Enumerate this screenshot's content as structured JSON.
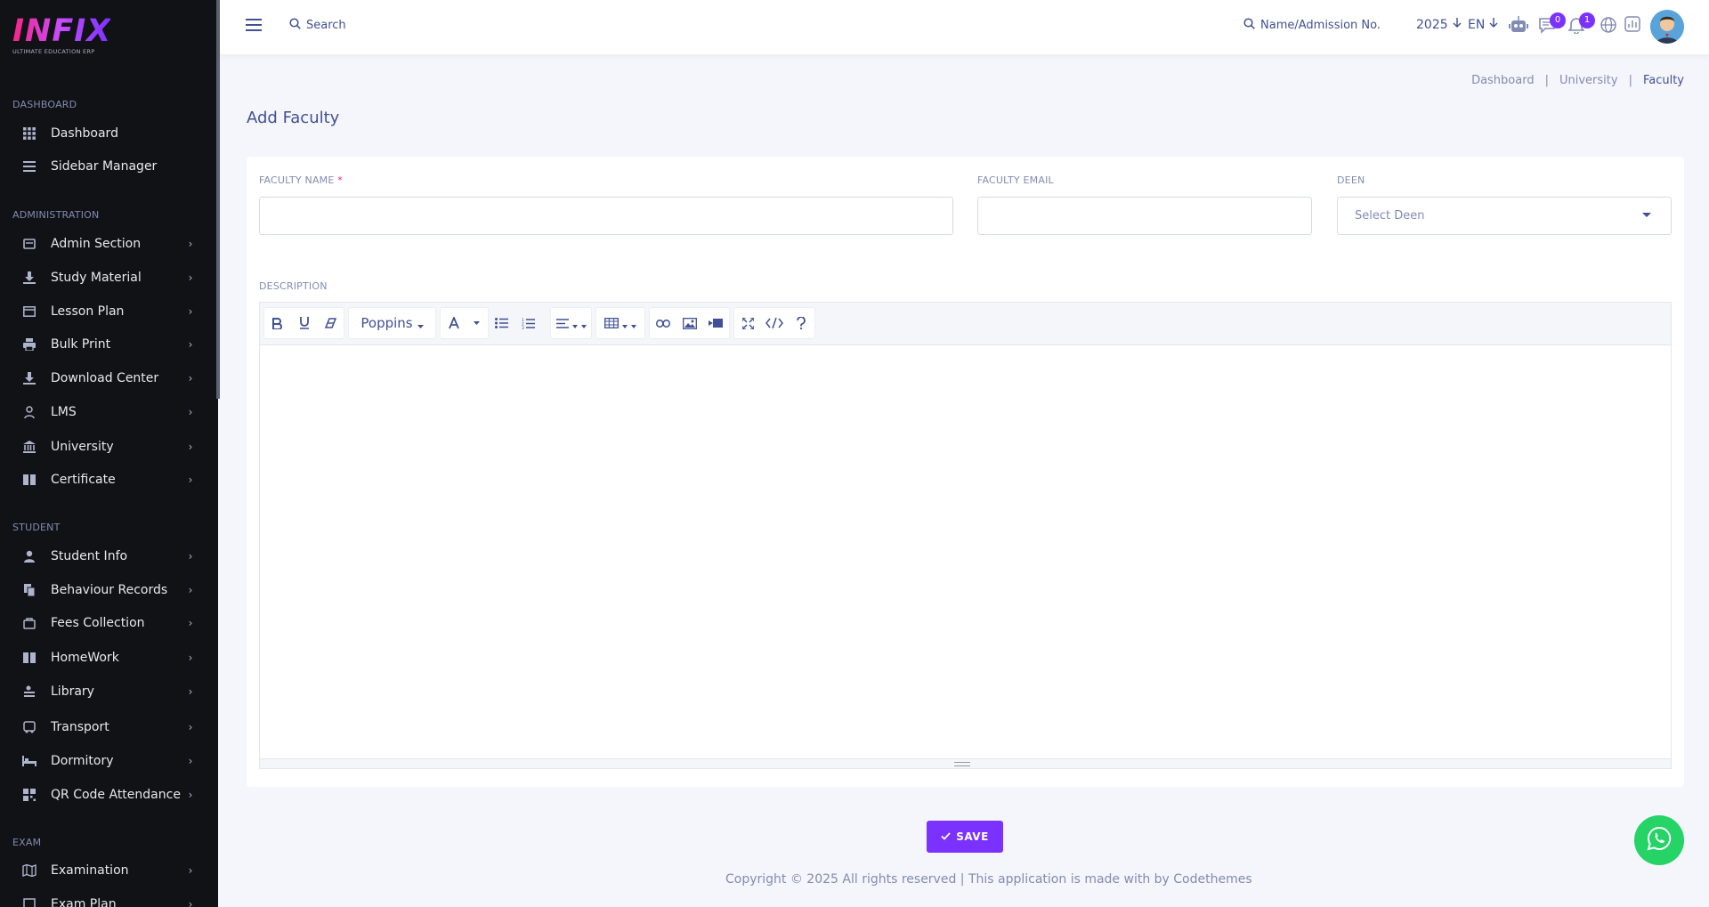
{
  "brand": {
    "logo_text": "INFIX",
    "logo_sub": "ULTIMATE EDUCATION ERP"
  },
  "sidebar": {
    "sections": [
      {
        "label": "DASHBOARD",
        "items": [
          {
            "label": "Dashboard",
            "icon": "grid-icon"
          },
          {
            "label": "Sidebar Manager",
            "icon": "list-icon"
          }
        ]
      },
      {
        "label": "ADMINISTRATION",
        "items": [
          {
            "label": "Admin Section",
            "icon": "admin-icon"
          },
          {
            "label": "Study Material",
            "icon": "download-icon"
          },
          {
            "label": "Lesson Plan",
            "icon": "lesson-icon"
          },
          {
            "label": "Bulk Print",
            "icon": "printer-icon"
          },
          {
            "label": "Download Center",
            "icon": "download-icon"
          },
          {
            "label": "LMS",
            "icon": "lms-icon"
          },
          {
            "label": "University",
            "icon": "university-icon"
          },
          {
            "label": "Certificate",
            "icon": "book-icon"
          }
        ]
      },
      {
        "label": "STUDENT",
        "items": [
          {
            "label": "Student Info",
            "icon": "user-icon"
          },
          {
            "label": "Behaviour Records",
            "icon": "records-icon"
          },
          {
            "label": "Fees Collection",
            "icon": "fees-icon"
          },
          {
            "label": "HomeWork",
            "icon": "book-icon"
          },
          {
            "label": "Library",
            "icon": "library-icon"
          },
          {
            "label": "Transport",
            "icon": "bus-icon"
          },
          {
            "label": "Dormitory",
            "icon": "bed-icon"
          },
          {
            "label": "QR Code Attendance",
            "icon": "qr-icon"
          }
        ]
      },
      {
        "label": "EXAM",
        "items": [
          {
            "label": "Examination",
            "icon": "map-icon"
          },
          {
            "label": "Exam Plan",
            "icon": "plan-icon"
          }
        ]
      }
    ]
  },
  "topbar": {
    "search_label": "Search",
    "admission_search_label": "Name/Admission No.",
    "year": "2025",
    "language": "EN",
    "messages_badge": "0",
    "notifications_badge": "1"
  },
  "breadcrumb": {
    "items": [
      "Dashboard",
      "University",
      "Faculty"
    ]
  },
  "page": {
    "title": "Add Faculty"
  },
  "form": {
    "faculty_name_label": "FACULTY NAME",
    "faculty_name_required": "*",
    "faculty_email_label": "FACULTY EMAIL",
    "deen_label": "DEEN",
    "deen_placeholder": "Select Deen",
    "description_label": "DESCRIPTION",
    "font_name": "Poppins",
    "save_label": "SAVE"
  },
  "footer": {
    "text": "Copyright © 2025 All rights reserved | This application is made with by Codethemes"
  },
  "colors": {
    "accent": "#7c32ff",
    "sidebar_bg": "#111216",
    "text_primary": "#415094",
    "whatsapp": "#25d366"
  }
}
